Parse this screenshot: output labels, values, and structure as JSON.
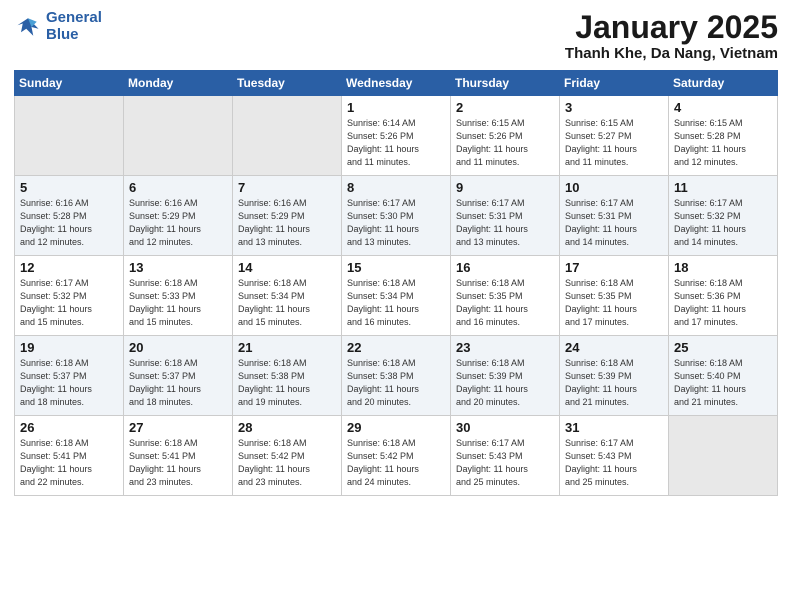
{
  "logo": {
    "line1": "General",
    "line2": "Blue"
  },
  "header": {
    "month": "January 2025",
    "location": "Thanh Khe, Da Nang, Vietnam"
  },
  "days_of_week": [
    "Sunday",
    "Monday",
    "Tuesday",
    "Wednesday",
    "Thursday",
    "Friday",
    "Saturday"
  ],
  "weeks": [
    [
      {
        "day": "",
        "info": ""
      },
      {
        "day": "",
        "info": ""
      },
      {
        "day": "",
        "info": ""
      },
      {
        "day": "1",
        "info": "Sunrise: 6:14 AM\nSunset: 5:26 PM\nDaylight: 11 hours\nand 11 minutes."
      },
      {
        "day": "2",
        "info": "Sunrise: 6:15 AM\nSunset: 5:26 PM\nDaylight: 11 hours\nand 11 minutes."
      },
      {
        "day": "3",
        "info": "Sunrise: 6:15 AM\nSunset: 5:27 PM\nDaylight: 11 hours\nand 11 minutes."
      },
      {
        "day": "4",
        "info": "Sunrise: 6:15 AM\nSunset: 5:28 PM\nDaylight: 11 hours\nand 12 minutes."
      }
    ],
    [
      {
        "day": "5",
        "info": "Sunrise: 6:16 AM\nSunset: 5:28 PM\nDaylight: 11 hours\nand 12 minutes."
      },
      {
        "day": "6",
        "info": "Sunrise: 6:16 AM\nSunset: 5:29 PM\nDaylight: 11 hours\nand 12 minutes."
      },
      {
        "day": "7",
        "info": "Sunrise: 6:16 AM\nSunset: 5:29 PM\nDaylight: 11 hours\nand 13 minutes."
      },
      {
        "day": "8",
        "info": "Sunrise: 6:17 AM\nSunset: 5:30 PM\nDaylight: 11 hours\nand 13 minutes."
      },
      {
        "day": "9",
        "info": "Sunrise: 6:17 AM\nSunset: 5:31 PM\nDaylight: 11 hours\nand 13 minutes."
      },
      {
        "day": "10",
        "info": "Sunrise: 6:17 AM\nSunset: 5:31 PM\nDaylight: 11 hours\nand 14 minutes."
      },
      {
        "day": "11",
        "info": "Sunrise: 6:17 AM\nSunset: 5:32 PM\nDaylight: 11 hours\nand 14 minutes."
      }
    ],
    [
      {
        "day": "12",
        "info": "Sunrise: 6:17 AM\nSunset: 5:32 PM\nDaylight: 11 hours\nand 15 minutes."
      },
      {
        "day": "13",
        "info": "Sunrise: 6:18 AM\nSunset: 5:33 PM\nDaylight: 11 hours\nand 15 minutes."
      },
      {
        "day": "14",
        "info": "Sunrise: 6:18 AM\nSunset: 5:34 PM\nDaylight: 11 hours\nand 15 minutes."
      },
      {
        "day": "15",
        "info": "Sunrise: 6:18 AM\nSunset: 5:34 PM\nDaylight: 11 hours\nand 16 minutes."
      },
      {
        "day": "16",
        "info": "Sunrise: 6:18 AM\nSunset: 5:35 PM\nDaylight: 11 hours\nand 16 minutes."
      },
      {
        "day": "17",
        "info": "Sunrise: 6:18 AM\nSunset: 5:35 PM\nDaylight: 11 hours\nand 17 minutes."
      },
      {
        "day": "18",
        "info": "Sunrise: 6:18 AM\nSunset: 5:36 PM\nDaylight: 11 hours\nand 17 minutes."
      }
    ],
    [
      {
        "day": "19",
        "info": "Sunrise: 6:18 AM\nSunset: 5:37 PM\nDaylight: 11 hours\nand 18 minutes."
      },
      {
        "day": "20",
        "info": "Sunrise: 6:18 AM\nSunset: 5:37 PM\nDaylight: 11 hours\nand 18 minutes."
      },
      {
        "day": "21",
        "info": "Sunrise: 6:18 AM\nSunset: 5:38 PM\nDaylight: 11 hours\nand 19 minutes."
      },
      {
        "day": "22",
        "info": "Sunrise: 6:18 AM\nSunset: 5:38 PM\nDaylight: 11 hours\nand 20 minutes."
      },
      {
        "day": "23",
        "info": "Sunrise: 6:18 AM\nSunset: 5:39 PM\nDaylight: 11 hours\nand 20 minutes."
      },
      {
        "day": "24",
        "info": "Sunrise: 6:18 AM\nSunset: 5:39 PM\nDaylight: 11 hours\nand 21 minutes."
      },
      {
        "day": "25",
        "info": "Sunrise: 6:18 AM\nSunset: 5:40 PM\nDaylight: 11 hours\nand 21 minutes."
      }
    ],
    [
      {
        "day": "26",
        "info": "Sunrise: 6:18 AM\nSunset: 5:41 PM\nDaylight: 11 hours\nand 22 minutes."
      },
      {
        "day": "27",
        "info": "Sunrise: 6:18 AM\nSunset: 5:41 PM\nDaylight: 11 hours\nand 23 minutes."
      },
      {
        "day": "28",
        "info": "Sunrise: 6:18 AM\nSunset: 5:42 PM\nDaylight: 11 hours\nand 23 minutes."
      },
      {
        "day": "29",
        "info": "Sunrise: 6:18 AM\nSunset: 5:42 PM\nDaylight: 11 hours\nand 24 minutes."
      },
      {
        "day": "30",
        "info": "Sunrise: 6:17 AM\nSunset: 5:43 PM\nDaylight: 11 hours\nand 25 minutes."
      },
      {
        "day": "31",
        "info": "Sunrise: 6:17 AM\nSunset: 5:43 PM\nDaylight: 11 hours\nand 25 minutes."
      },
      {
        "day": "",
        "info": ""
      }
    ]
  ]
}
